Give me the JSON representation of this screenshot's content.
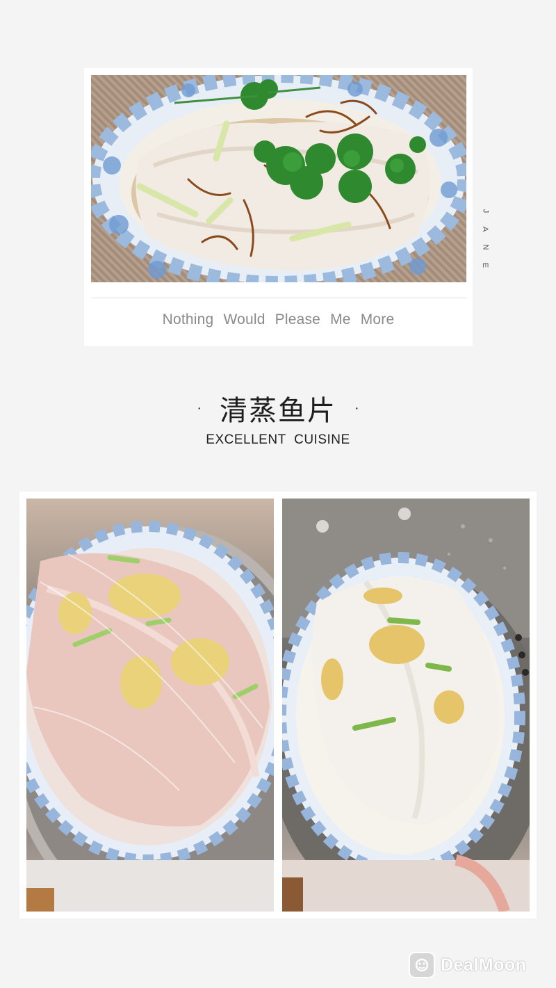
{
  "card": {
    "caption": "Nothing Would Please Me More",
    "signature_letters": [
      "J",
      "A",
      "N",
      "E"
    ]
  },
  "title": {
    "main": "清蒸鱼片",
    "dot_left": "·",
    "dot_right": "·",
    "subtitle": "EXCELLENT CUISINE"
  },
  "photos": {
    "top": "finished steamed fish fillet with cilantro, scallion and fried shallot on blue floral plate",
    "bottom_left": "raw fish fillets with ginger and scallion under plastic wrap in steamer",
    "bottom_right": "steamed fish fillets under plastic wrap in steamer pot"
  },
  "watermark": {
    "text": "DealMoon",
    "icon": "dealmoon-logo-icon"
  },
  "colors": {
    "background": "#f4f4f4",
    "card": "#ffffff",
    "caption": "#8a8a8a",
    "title": "#1e1e1e",
    "plate_blue": "#7fa6d6"
  }
}
